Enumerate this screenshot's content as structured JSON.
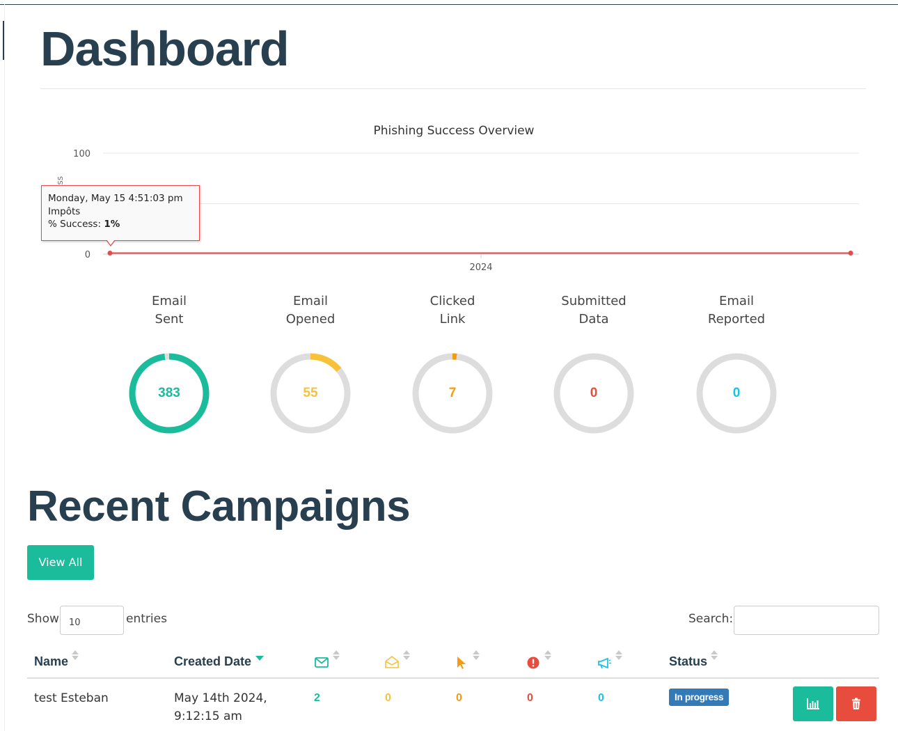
{
  "page": {
    "title": "Dashboard"
  },
  "chart_data": {
    "type": "line",
    "title": "Phishing Success Overview",
    "ylabel": "% of Success",
    "ylim": [
      0,
      100
    ],
    "y_ticks": [
      "100",
      "0"
    ],
    "x_ticks": [
      "2024"
    ],
    "series": [
      {
        "name": "% Success",
        "color": "#e44b4b",
        "points": [
          {
            "x": "2024-05-15T16:51:03",
            "y": 1,
            "campaign": "Impôts"
          },
          {
            "x": "2024-05-17T00:00:00",
            "y": 1
          }
        ]
      }
    ],
    "tooltip": {
      "date": "Monday, May 15 4:51:03 pm",
      "campaign": "Impôts",
      "label": "% Success: ",
      "value": "1%"
    }
  },
  "stats": [
    {
      "line1": "Email",
      "line2": "Sent",
      "value": "383",
      "fraction": 0.98,
      "color": "#1abc9c"
    },
    {
      "line1": "Email",
      "line2": "Opened",
      "value": "55",
      "fraction": 0.14,
      "color": "#f7c13a"
    },
    {
      "line1": "Clicked",
      "line2": "Link",
      "value": "7",
      "fraction": 0.018,
      "color": "#f39c12"
    },
    {
      "line1": "Submitted",
      "line2": "Data",
      "value": "0",
      "fraction": 0,
      "color": "#e74c3c"
    },
    {
      "line1": "Email",
      "line2": "Reported",
      "value": "0",
      "fraction": 0,
      "color": "#17c4e6"
    }
  ],
  "campaigns": {
    "title": "Recent Campaigns",
    "view_all": "View All",
    "show_label": "Show",
    "page_length": "10",
    "entries_label": "entries",
    "search_label": "Search:",
    "headers": {
      "name": "Name",
      "created": "Created Date",
      "status": "Status"
    },
    "icons": [
      "envelope-icon",
      "envelope-open-icon",
      "cursor-icon",
      "exclamation-circle-icon",
      "bullhorn-icon"
    ],
    "rows": [
      {
        "name": "test Esteban",
        "created_line1": "May 14th 2024,",
        "created_line2": "9:12:15 am",
        "sent": "2",
        "opened": "0",
        "clicked": "0",
        "submitted": "0",
        "reported": "0",
        "status": "In progress"
      }
    ]
  }
}
